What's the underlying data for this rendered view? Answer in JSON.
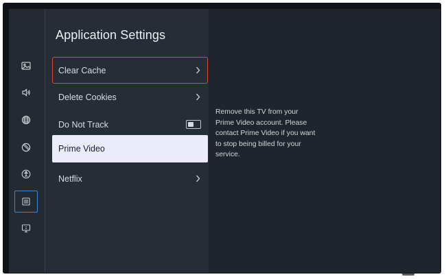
{
  "page_title": "Application Settings",
  "menu": {
    "items": [
      {
        "label": "Clear Cache",
        "control": "chevron",
        "state": "focused"
      },
      {
        "label": "Delete Cookies",
        "control": "chevron",
        "state": "normal"
      },
      {
        "label": "Do Not Track",
        "control": "toggle",
        "toggle_on": false,
        "state": "normal"
      },
      {
        "label": "Prime Video",
        "control": "none",
        "state": "highlighted"
      },
      {
        "label": "Netflix",
        "control": "chevron",
        "state": "normal"
      }
    ]
  },
  "description": "Remove this TV from your Prime Video account. Please contact Prime Video if you want to stop being billed for your service.",
  "side_rail": {
    "icons": [
      "picture-icon",
      "sound-icon",
      "network-icon",
      "restrictions-icon",
      "accessibility-icon",
      "apps-icon",
      "device-icon"
    ],
    "selected": "apps-icon"
  },
  "colors": {
    "screen_bg": "#232a32",
    "menu_bg": "#262d36",
    "detail_bg": "#1f252c",
    "focus_border": "#e0492f",
    "selected_rail_border": "#3d86d8",
    "highlight_bg": "#ecebf9"
  }
}
